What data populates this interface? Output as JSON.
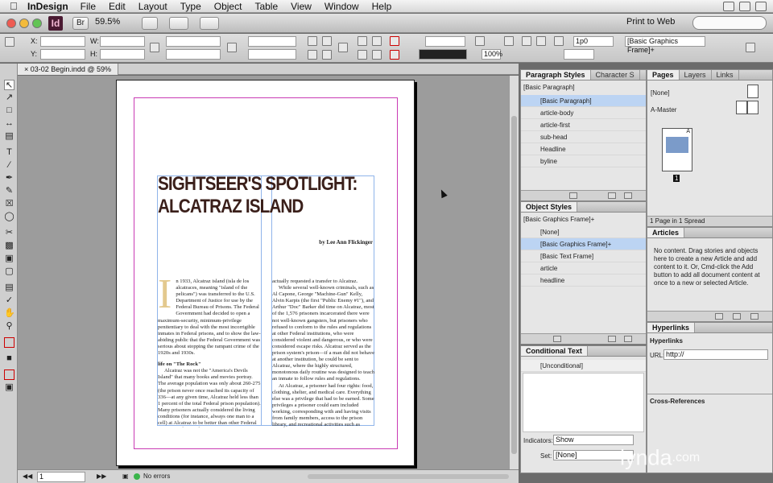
{
  "menubar": {
    "app": "InDesign",
    "items": [
      "File",
      "Edit",
      "Layout",
      "Type",
      "Object",
      "Table",
      "View",
      "Window",
      "Help"
    ]
  },
  "appbar": {
    "logo": "Id",
    "br_label": "Br",
    "zoom": "59.5%",
    "workspace": "Print to Web"
  },
  "control": {
    "x_label": "X:",
    "y_label": "Y:",
    "w_label": "W:",
    "h_label": "H:",
    "zoom_field": "100%",
    "pt_field": "1p0",
    "style_field": "[Basic Graphics Frame]+"
  },
  "document": {
    "tab": "03-02 Begin.indd @ 59%",
    "headline_1": "SIGHTSEER'S SPOTLIGHT:",
    "headline_2": "ALCATRAZ ISLAND",
    "byline": "by Lee Ann Flickinger",
    "dropcap": "I",
    "col1_p1": "n 1933, Alcatraz island (isla de los alcatraces, meaning \"island of the pelicans\") was transferred to the U.S. Department of Justice for use by the Federal Bureau of Prisons. The Federal Government had decided to open a maximum-security, minimum-privilege penitentiary to deal with the most incorrigible inmates in Federal prisons, and to show the law-abiding public that the Federal Government was serious about stopping the rampant crime of the 1920s and 1930s.",
    "col1_sub": "life on \"The Rock\"",
    "col1_p2": "Alcatraz was not the \"America's Devils Island\" that many books and movies portray. The average population was only about 260-275 (the prison never once reached its capacity of 336—at any given time, Alcatraz held less than 1 percent of the total Federal prison population). Many prisoners actually considered the living conditions (for instance, always one man to a cell) at Alcatraz to be better than other Federal prisons, and several inmates",
    "col2_p1": "actually requested a transfer to Alcatraz.",
    "col2_p2": "While several well-known criminals, such as Al Capone, George \"Machine-Gun\" Kelly, Alvin Karpis (the first \"Public Enemy #1\"), and Arthur \"Doc\" Barker did time on Alcatraz, most of the 1,576 prisoners incarcerated there were not well-known gangsters, but prisoners who refused to conform to the rules and regulations at other Federal institutions, who were considered violent and dangerous, or who were considered escape risks. Alcatraz served as the prison system's prison—if a man did not behave at another institution, he could be sent to Alcatraz, where the highly structured, monotonous daily routine was designed to teach an inmate to follow rules and regulations.",
    "col2_p3": "At Alcatraz, a prisoner had four rights: food, clothing, shelter, and medical care. Everything else was a privilege that had to be earned. Some privileges a prisoner could earn included working, corresponding with and having visits from family members, access to the prison library, and recreational activities such as painting and music."
  },
  "status": {
    "page": "1",
    "errors": "No errors"
  },
  "paragraph_styles": {
    "tabs": [
      "Paragraph Styles",
      "Character S"
    ],
    "current": "[Basic Paragraph]",
    "items": [
      "[Basic Paragraph]",
      "article-body",
      "article-first",
      "sub-head",
      "Headline",
      "byline"
    ],
    "selected": 0
  },
  "object_styles": {
    "tabs": [
      "Object Styles"
    ],
    "current": "[Basic Graphics Frame]+",
    "items": [
      "[None]",
      "[Basic Graphics Frame]+",
      "[Basic Text Frame]",
      "article",
      "headline"
    ],
    "selected": 1
  },
  "conditional_text": {
    "tabs": [
      "Conditional Text"
    ],
    "items": [
      "[Unconditional]"
    ],
    "indicators_label": "Indicators:",
    "indicators_value": "Show",
    "set_label": "Set:",
    "set_value": "[None]"
  },
  "pages": {
    "tabs": [
      "Pages",
      "Layers",
      "Links"
    ],
    "none_label": "[None]",
    "master_label": "A-Master",
    "page_number": "1",
    "master_letter": "A",
    "footer": "1 Page in 1 Spread"
  },
  "articles": {
    "tabs": [
      "Articles"
    ],
    "message": "No content. Drag stories and objects here to create a new Article and add content to it. Or, Cmd-click the Add button to add all document content at once to a new or selected Article."
  },
  "hyperlinks": {
    "tabs": [
      "Hyperlinks"
    ],
    "title": "Hyperlinks",
    "url_label": "URL:",
    "url_value": "http://",
    "cross_refs": "Cross-References"
  },
  "watermark": {
    "name": "lynda",
    "suffix": ".com"
  }
}
